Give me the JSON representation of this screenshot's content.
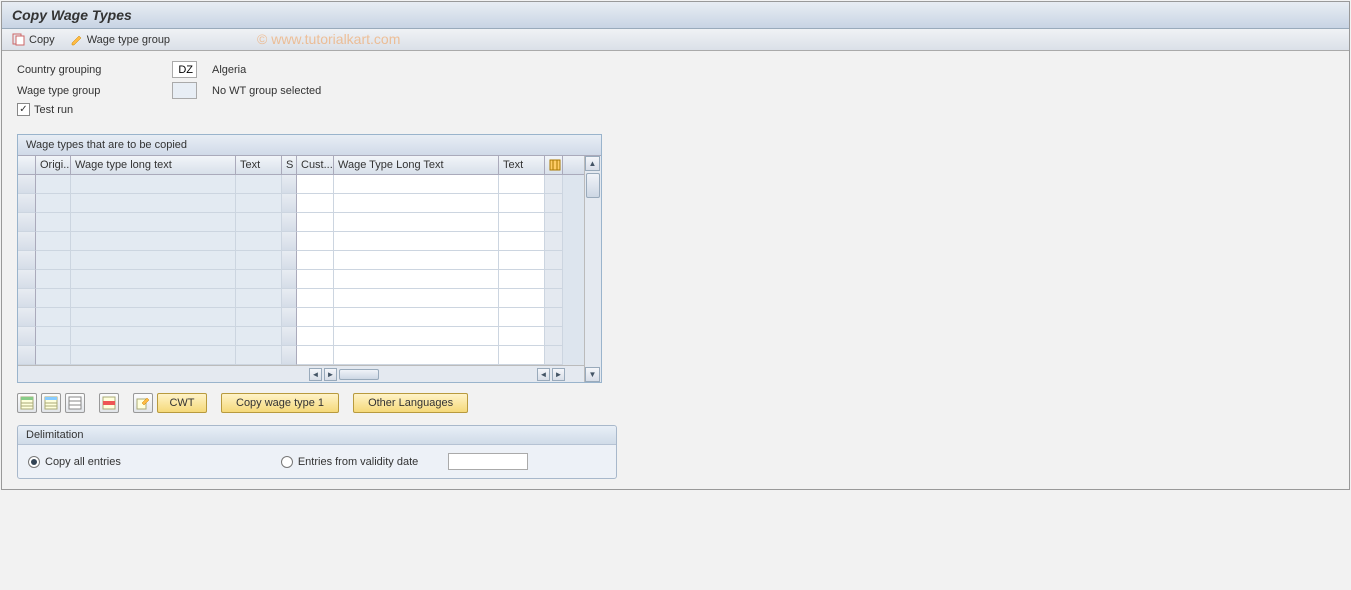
{
  "title": "Copy Wage Types",
  "toolbar": {
    "copy": "Copy",
    "wage_type_group": "Wage type group"
  },
  "watermark": "© www.tutorialkart.com",
  "fields": {
    "country_grouping_label": "Country grouping",
    "country_grouping_value": "DZ",
    "country_grouping_text": "Algeria",
    "wage_type_group_label": "Wage type group",
    "wage_type_group_value": "",
    "wage_type_group_text": "No WT group selected",
    "test_run_label": "Test run",
    "test_run_checked": true
  },
  "table": {
    "title": "Wage types that are to be copied",
    "columns": {
      "origi": "Origi...",
      "long1": "Wage type long text",
      "text1": "Text",
      "s": "S",
      "cust": "Cust...",
      "long2": "Wage Type Long Text",
      "text2": "Text"
    },
    "row_count": 10
  },
  "buttons": {
    "cwt": "CWT",
    "copy_wage_type_1": "Copy wage type 1",
    "other_languages": "Other Languages"
  },
  "delimitation": {
    "title": "Delimitation",
    "copy_all": "Copy all entries",
    "entries_from": "Entries from validity date",
    "selected": "copy_all",
    "date_value": ""
  }
}
